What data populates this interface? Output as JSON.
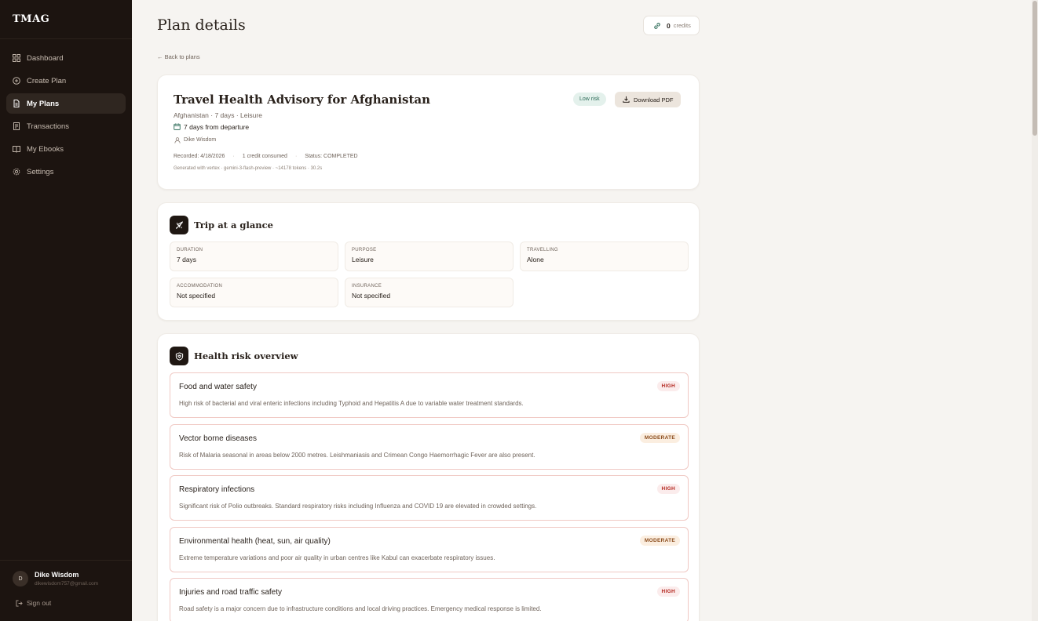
{
  "app": {
    "brand": "TMAG"
  },
  "sidebar": {
    "items": [
      {
        "label": "Dashboard",
        "icon": "grid-icon",
        "active": false
      },
      {
        "label": "Create Plan",
        "icon": "plus-circle-icon",
        "active": false
      },
      {
        "label": "My Plans",
        "icon": "document-icon",
        "active": true
      },
      {
        "label": "Transactions",
        "icon": "receipt-icon",
        "active": false
      },
      {
        "label": "My Ebooks",
        "icon": "book-icon",
        "active": false
      },
      {
        "label": "Settings",
        "icon": "gear-icon",
        "active": false
      }
    ],
    "user": {
      "initial": "D",
      "name": "Dike Wisdom",
      "email": "dikewisdom757@gmail.com"
    },
    "signout": "Sign out"
  },
  "header": {
    "title": "Plan details",
    "credits_count": "0",
    "credits_label": "credits",
    "back": "← Back to plans"
  },
  "plan": {
    "title": "Travel Health Advisory for Afghanistan",
    "subtitle": "Afghanistan · 7 days · Leisure",
    "departure": "7 days from departure",
    "author": "Dike Wisdom",
    "recorded": "Recorded: 4/18/2026",
    "credits": "1 credit consumed",
    "status": "Status: COMPLETED",
    "generated": "Generated with vertex · gemini-3-flash-preview · ~14178 tokens · 30.2s",
    "risk_label": "Low risk",
    "download_label": "Download PDF"
  },
  "glance": {
    "title": "Trip at a glance",
    "tiles": [
      {
        "key": "DURATION",
        "value": "7 days"
      },
      {
        "key": "PURPOSE",
        "value": "Leisure"
      },
      {
        "key": "TRAVELLING",
        "value": "Alone"
      },
      {
        "key": "ACCOMMODATION",
        "value": "Not specified"
      },
      {
        "key": "INSURANCE",
        "value": "Not specified"
      }
    ]
  },
  "health": {
    "title": "Health risk overview",
    "risks": [
      {
        "title": "Food and water safety",
        "level": "HIGH",
        "desc": "High risk of bacterial and viral enteric infections including Typhoid and Hepatitis A due to variable water treatment standards."
      },
      {
        "title": "Vector borne diseases",
        "level": "MODERATE",
        "desc": "Risk of Malaria seasonal in areas below 2000 metres. Leishmaniasis and Crimean Congo Haemorrhagic Fever are also present."
      },
      {
        "title": "Respiratory infections",
        "level": "HIGH",
        "desc": "Significant risk of Polio outbreaks. Standard respiratory risks including Influenza and COVID 19 are elevated in crowded settings."
      },
      {
        "title": "Environmental health (heat, sun, air quality)",
        "level": "MODERATE",
        "desc": "Extreme temperature variations and poor air quality in urban centres like Kabul can exacerbate respiratory issues."
      },
      {
        "title": "Injuries and road traffic safety",
        "level": "HIGH",
        "desc": "Road safety is a major concern due to infrastructure conditions and local driving practices. Emergency medical response is limited."
      }
    ]
  },
  "colors": {
    "sidebar_bg": "#1c1410",
    "high": "#b3261e",
    "moderate": "#8a4a1a",
    "low_risk": "#2d6b58"
  }
}
